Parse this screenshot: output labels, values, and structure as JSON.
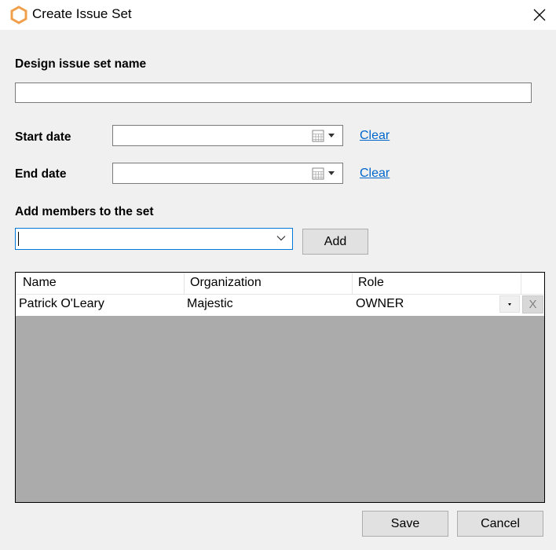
{
  "window": {
    "title": "Create Issue Set",
    "icon": "hexagon-logo-icon",
    "close_icon": "close-icon"
  },
  "form": {
    "name_label": "Design issue set name",
    "name_value": "",
    "start_date_label": "Start date",
    "start_date_value": "",
    "end_date_label": "End date",
    "end_date_value": "",
    "clear_label": "Clear",
    "members_label": "Add members to the set",
    "member_value": "",
    "add_label": "Add"
  },
  "members_table": {
    "columns": [
      "Name",
      "Organization",
      "Role"
    ],
    "rows": [
      {
        "name": "Patrick O'Leary",
        "organization": "Majestic",
        "role": "OWNER",
        "remove": "X"
      }
    ]
  },
  "footer": {
    "save_label": "Save",
    "cancel_label": "Cancel"
  },
  "colors": {
    "accent": "#0078d7",
    "link": "#0066cc",
    "logo": "#f0a04b",
    "grid_empty": "#ababab"
  }
}
